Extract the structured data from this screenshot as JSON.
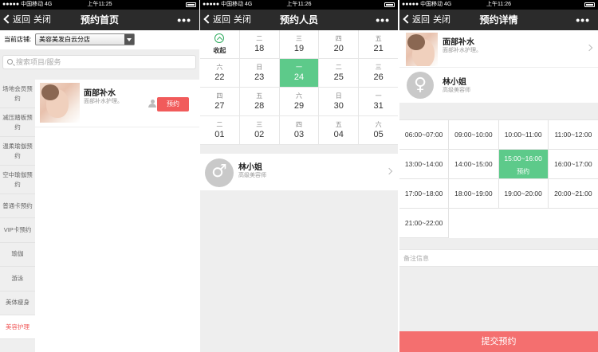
{
  "status": {
    "carrier": "●●●●● 中国移动  4G",
    "time_s1": "上午11:25",
    "time_s2": "上午11:26",
    "time_s3": "上午11:26"
  },
  "nav": {
    "back_label": "返回",
    "close_label": "关闭",
    "more_label": "•••",
    "title_s1": "预约首页",
    "title_s2": "预约人员",
    "title_s3": "预约详情"
  },
  "store": {
    "label": "当前店铺:",
    "selected": "美容美发白云分店"
  },
  "search": {
    "placeholder": "搜索项目/服务"
  },
  "categories": [
    {
      "label": "场地会员预约"
    },
    {
      "label": "减压踏板预约"
    },
    {
      "label": "温柔瑜伽预约"
    },
    {
      "label": "空中瑜伽预约"
    },
    {
      "label": "普通卡预约"
    },
    {
      "label": "VIP卡预约"
    },
    {
      "label": "瑜伽"
    },
    {
      "label": "游泳"
    },
    {
      "label": "美体瘦身"
    },
    {
      "label": "美容护理"
    }
  ],
  "service": {
    "name": "面部补水",
    "desc": "面部补水护理。",
    "book_label": "预约"
  },
  "calendar": {
    "collapse_label": "收起",
    "rows": [
      [
        {
          "wd": "",
          "dn": ""
        },
        {
          "wd": "二",
          "dn": "18"
        },
        {
          "wd": "三",
          "dn": "19"
        },
        {
          "wd": "四",
          "dn": "20"
        },
        {
          "wd": "五",
          "dn": "21"
        }
      ],
      [
        {
          "wd": "六",
          "dn": "22"
        },
        {
          "wd": "日",
          "dn": "23"
        },
        {
          "wd": "一",
          "dn": "24"
        },
        {
          "wd": "二",
          "dn": "25"
        },
        {
          "wd": "三",
          "dn": "26"
        }
      ],
      [
        {
          "wd": "四",
          "dn": "27"
        },
        {
          "wd": "五",
          "dn": "28"
        },
        {
          "wd": "六",
          "dn": "29"
        },
        {
          "wd": "日",
          "dn": "30"
        },
        {
          "wd": "一",
          "dn": "31"
        }
      ],
      [
        {
          "wd": "二",
          "dn": "01"
        },
        {
          "wd": "三",
          "dn": "02"
        },
        {
          "wd": "四",
          "dn": "03"
        },
        {
          "wd": "五",
          "dn": "04"
        },
        {
          "wd": "六",
          "dn": "05"
        }
      ]
    ]
  },
  "staff": {
    "name": "林小姐",
    "title": "高级美容师",
    "gender_symbol_male": "♂",
    "gender_symbol_female": "♀"
  },
  "slots": [
    {
      "time": "06:00~07:00"
    },
    {
      "time": "09:00~10:00"
    },
    {
      "time": "10:00~11:00"
    },
    {
      "time": "11:00~12:00"
    },
    {
      "time": "13:00~14:00"
    },
    {
      "time": "14:00~15:00"
    },
    {
      "time": "15:00~16:00",
      "sub": "预约"
    },
    {
      "time": "16:00~17:00"
    },
    {
      "time": "17:00~18:00"
    },
    {
      "time": "18:00~19:00"
    },
    {
      "time": "19:00~20:00"
    },
    {
      "time": "20:00~21:00"
    },
    {
      "time": "21:00~22:00"
    }
  ],
  "notes": {
    "placeholder": "备注信息"
  },
  "submit_label": "提交预约",
  "colors": {
    "accent_green": "#5dca8a",
    "accent_red": "#f15b5b",
    "nav_bg": "#2b2b2b"
  }
}
